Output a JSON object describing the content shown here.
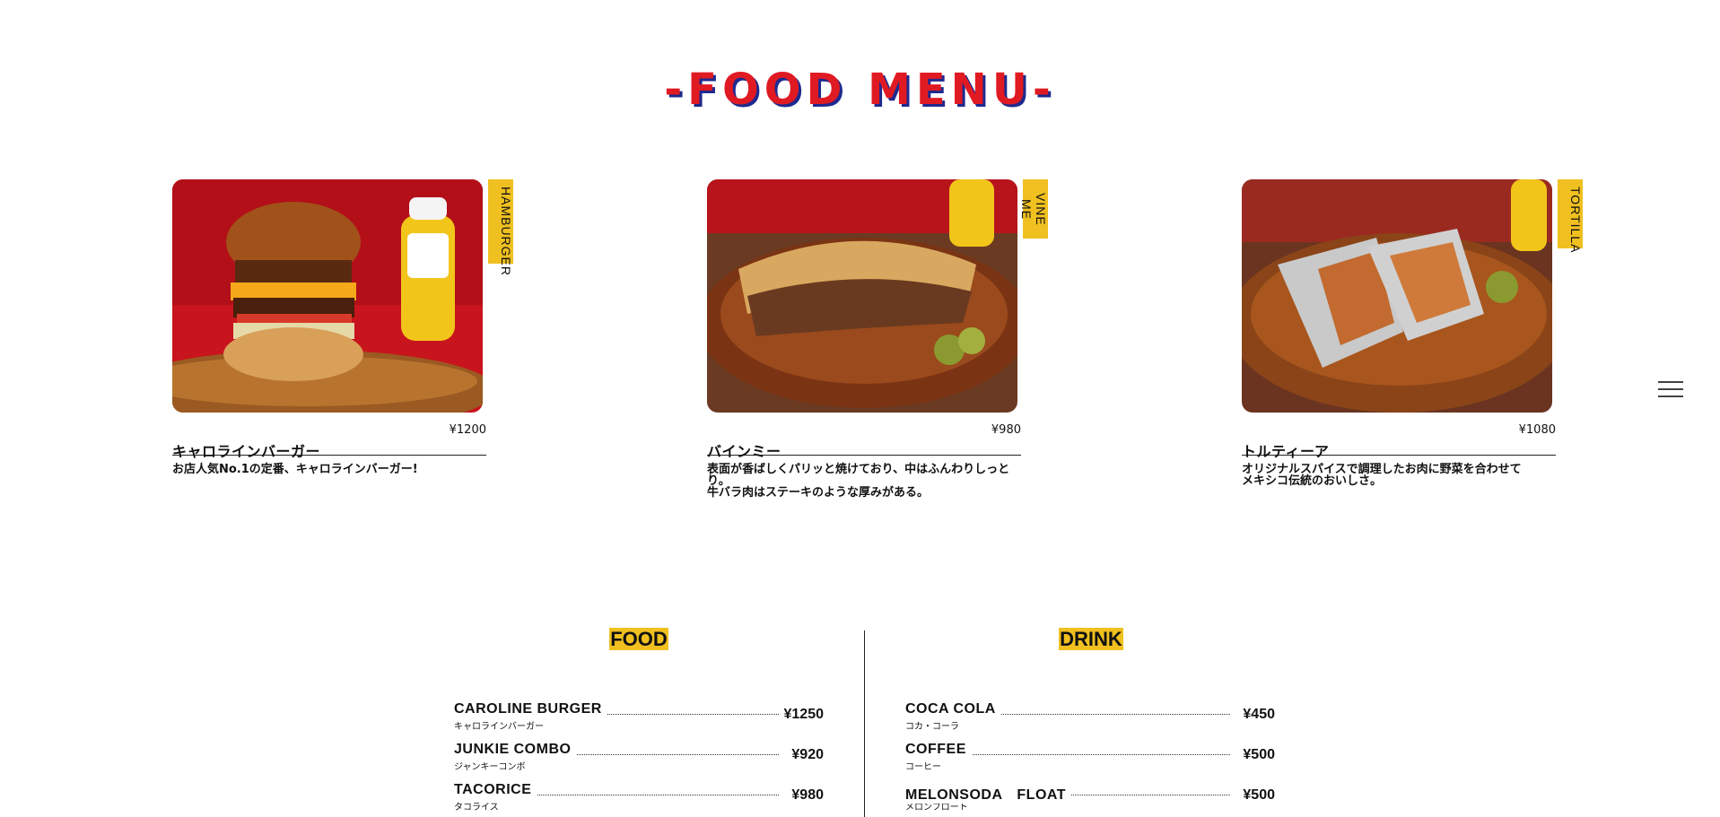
{
  "header": {
    "title": "-FOOD MENU-"
  },
  "cards": [
    {
      "tag": "HAMBURGER",
      "name": "キャロラインバーガー",
      "price": "¥1200",
      "description": "お店人気No.1の定番、キャロラインバーガー!"
    },
    {
      "tag": "VINE ME",
      "name": "バインミー",
      "price": "¥980",
      "description": "表面が香ばしくパリッと焼けており、中はふんわりしっと\nり。\n牛バラ肉はステーキのような厚みがある。"
    },
    {
      "tag": "TORTILLA",
      "name": "トルティーア",
      "price": "¥1080",
      "description": "オリジナルスパイスで調理したお肉に野菜を合わせて\nメキシコ伝統のおいしさ。"
    }
  ],
  "food": {
    "heading": "FOOD",
    "items": [
      {
        "en": "CAROLINE BURGER",
        "ja": "キャロラインバーガー",
        "price": "¥1250"
      },
      {
        "en": "JUNKIE COMBO",
        "ja": "ジャンキーコンボ",
        "price": "¥920"
      },
      {
        "en": "TACORICE",
        "ja": "タコライス",
        "price": "¥980"
      }
    ]
  },
  "drink": {
    "heading": "DRINK",
    "items": [
      {
        "en": "COCA COLA",
        "ja": "コカ・コーラ",
        "price": "¥450"
      },
      {
        "en": "COFFEE",
        "ja": "コーヒー",
        "price": "¥500"
      },
      {
        "en": "MELONSODA　FLOAT",
        "ja": "メロンフロート",
        "price": "¥500"
      }
    ]
  },
  "icons": {
    "menu": "hamburger-menu-icon"
  },
  "colors": {
    "title_red": "#e01a22",
    "title_shadow": "#1e2a8f",
    "tag_yellow": "#f0c020"
  }
}
